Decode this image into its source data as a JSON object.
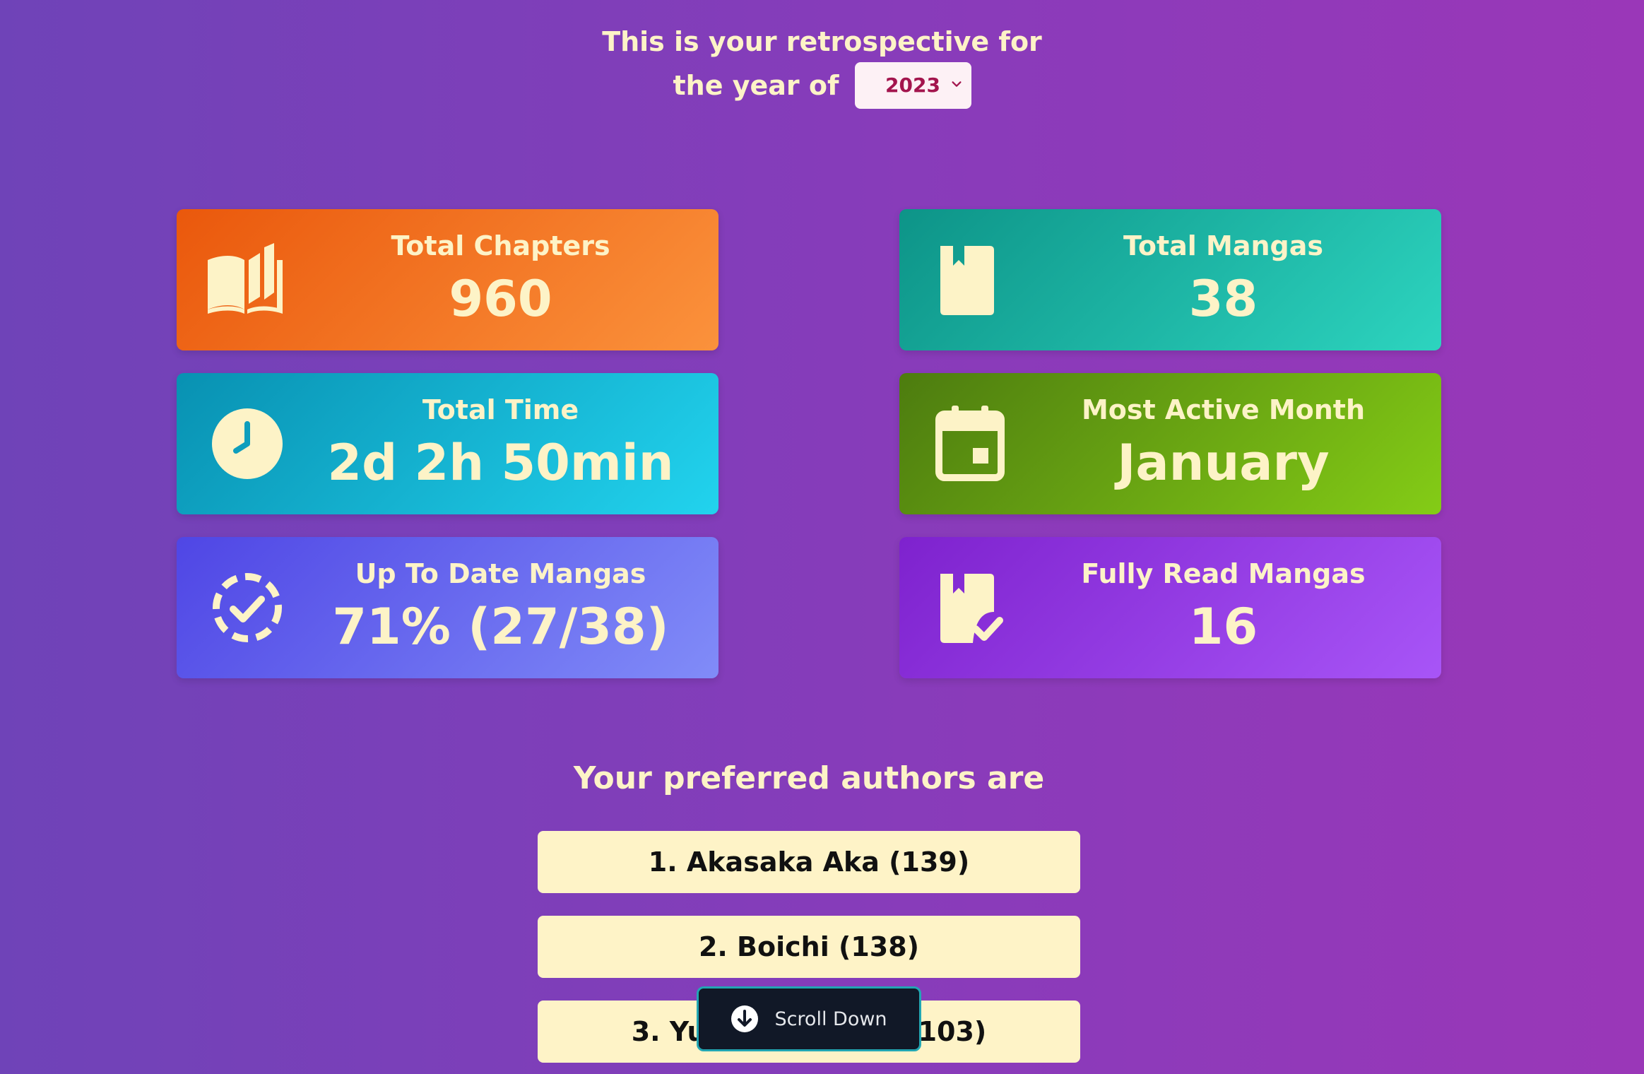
{
  "header": {
    "line1": "This is your retrospective for",
    "line2": "the year of",
    "year_selected": "2023"
  },
  "stats": {
    "total_chapters": {
      "label": "Total Chapters",
      "value": "960",
      "icon": "open-book-icon"
    },
    "total_mangas": {
      "label": "Total Mangas",
      "value": "38",
      "icon": "bookmark-book-icon"
    },
    "total_time": {
      "label": "Total Time",
      "value": "2d 2h 50min",
      "icon": "clock-icon"
    },
    "most_active_month": {
      "label": "Most Active Month",
      "value": "January",
      "icon": "calendar-icon"
    },
    "up_to_date": {
      "label": "Up To Date Mangas",
      "value": "71% (27/38)",
      "icon": "dashed-circle-check-icon"
    },
    "fully_read": {
      "label": "Fully Read Mangas",
      "value": "16",
      "icon": "book-check-icon"
    }
  },
  "authors": {
    "title": "Your preferred authors are",
    "items": [
      {
        "label": "1. Akasaka Aka (139)"
      },
      {
        "label": "2. Boichi (138)"
      },
      {
        "label": "3. Yu",
        "suffix": "103)"
      }
    ]
  },
  "scroll_button": {
    "label": "Scroll Down",
    "icon": "arrow-down-circle-icon"
  },
  "colors": {
    "accent_text": "#fdf3c7",
    "orange": "#ea580c",
    "teal": "#0d9488",
    "cyan": "#0891b2",
    "green": "#4d7c0f",
    "indigo": "#4f46e5",
    "purple": "#7e22ce"
  }
}
